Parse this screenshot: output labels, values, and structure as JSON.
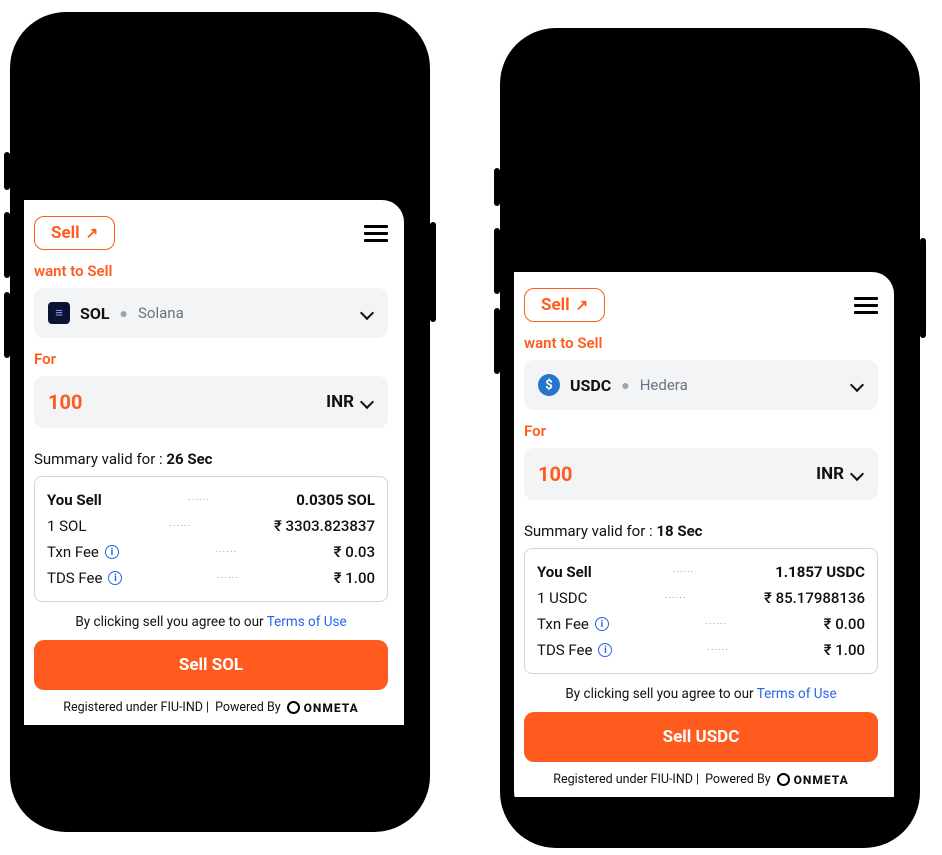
{
  "phones": [
    {
      "header": {
        "sell_label": "Sell",
        "arrow": "↗"
      },
      "want_label": "want to Sell",
      "token": {
        "symbol": "SOL",
        "chain": "Solana",
        "icon": "sol"
      },
      "for_label": "For",
      "amount": {
        "value": "100",
        "currency": "INR"
      },
      "summary_prefix": "Summary valid for : ",
      "summary_seconds": "26 Sec",
      "rows": {
        "you_sell_label": "You Sell",
        "you_sell_value": "0.0305 SOL",
        "rate_label": "1 SOL",
        "rate_value": "₹ 3303.823837",
        "txn_label": "Txn Fee",
        "txn_value": "₹ 0.03",
        "tds_label": "TDS Fee",
        "tds_value": "₹ 1.00"
      },
      "terms_prefix": "By clicking sell you agree to our ",
      "terms_link": "Terms of Use",
      "sell_button": "Sell SOL",
      "footer_reg": "Registered under FIU-IND |",
      "footer_pow": "Powered By",
      "footer_brand": "ONMETA"
    },
    {
      "header": {
        "sell_label": "Sell",
        "arrow": "↗"
      },
      "want_label": "want to Sell",
      "token": {
        "symbol": "USDC",
        "chain": "Hedera",
        "icon": "usdc"
      },
      "for_label": "For",
      "amount": {
        "value": "100",
        "currency": "INR"
      },
      "summary_prefix": "Summary valid for : ",
      "summary_seconds": "18 Sec",
      "rows": {
        "you_sell_label": "You Sell",
        "you_sell_value": "1.1857 USDC",
        "rate_label": "1 USDC",
        "rate_value": "₹ 85.17988136",
        "txn_label": "Txn Fee",
        "txn_value": "₹ 0.00",
        "tds_label": "TDS Fee",
        "tds_value": "₹ 1.00"
      },
      "terms_prefix": "By clicking sell you agree to our ",
      "terms_link": "Terms of Use",
      "sell_button": "Sell USDC",
      "footer_reg": "Registered under FIU-IND |",
      "footer_pow": "Powered By",
      "footer_brand": "ONMETA"
    }
  ],
  "dots": "······"
}
